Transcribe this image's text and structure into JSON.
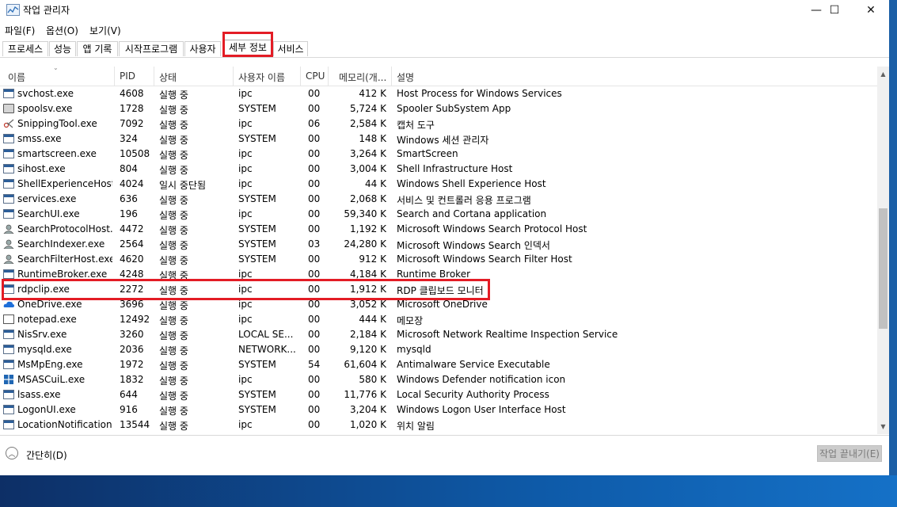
{
  "window": {
    "title": "작업 관리자",
    "minimize": "—",
    "maximize": "☐",
    "close": "✕"
  },
  "menu": [
    "파일(F)",
    "옵션(O)",
    "보기(V)"
  ],
  "tabs": [
    "프로세스",
    "성능",
    "앱 기록",
    "시작프로그램",
    "사용자",
    "세부 정보",
    "서비스"
  ],
  "active_tab": "세부 정보",
  "columns": [
    "이름",
    "PID",
    "상태",
    "사용자 이름",
    "CPU",
    "메모리(개...",
    "설명"
  ],
  "rows": [
    {
      "name": "svchost.exe",
      "pid": "4608",
      "status": "실행 중",
      "user": "ipc",
      "cpu": "00",
      "mem": "412 K",
      "desc": "Host Process for Windows Services",
      "icon": "app-icon"
    },
    {
      "name": "spoolsv.exe",
      "pid": "1728",
      "status": "실행 중",
      "user": "SYSTEM",
      "cpu": "00",
      "mem": "5,724 K",
      "desc": "Spooler SubSystem App",
      "icon": "printer-icon"
    },
    {
      "name": "SnippingTool.exe",
      "pid": "7092",
      "status": "실행 중",
      "user": "ipc",
      "cpu": "06",
      "mem": "2,584 K",
      "desc": "캡처 도구",
      "icon": "scissors-icon"
    },
    {
      "name": "smss.exe",
      "pid": "324",
      "status": "실행 중",
      "user": "SYSTEM",
      "cpu": "00",
      "mem": "148 K",
      "desc": "Windows 세션 관리자",
      "icon": "app-icon"
    },
    {
      "name": "smartscreen.exe",
      "pid": "10508",
      "status": "실행 중",
      "user": "ipc",
      "cpu": "00",
      "mem": "3,264 K",
      "desc": "SmartScreen",
      "icon": "app-icon"
    },
    {
      "name": "sihost.exe",
      "pid": "804",
      "status": "실행 중",
      "user": "ipc",
      "cpu": "00",
      "mem": "3,004 K",
      "desc": "Shell Infrastructure Host",
      "icon": "app-icon"
    },
    {
      "name": "ShellExperienceHost...",
      "pid": "4024",
      "status": "일시 중단됨",
      "user": "ipc",
      "cpu": "00",
      "mem": "44 K",
      "desc": "Windows Shell Experience Host",
      "icon": "app-icon"
    },
    {
      "name": "services.exe",
      "pid": "636",
      "status": "실행 중",
      "user": "SYSTEM",
      "cpu": "00",
      "mem": "2,068 K",
      "desc": "서비스 및 컨트롤러 응용 프로그램",
      "icon": "app-icon"
    },
    {
      "name": "SearchUI.exe",
      "pid": "196",
      "status": "실행 중",
      "user": "ipc",
      "cpu": "00",
      "mem": "59,340 K",
      "desc": "Search and Cortana application",
      "icon": "app-icon"
    },
    {
      "name": "SearchProtocolHost....",
      "pid": "4472",
      "status": "실행 중",
      "user": "SYSTEM",
      "cpu": "00",
      "mem": "1,192 K",
      "desc": "Microsoft Windows Search Protocol Host",
      "icon": "search-user-icon"
    },
    {
      "name": "SearchIndexer.exe",
      "pid": "2564",
      "status": "실행 중",
      "user": "SYSTEM",
      "cpu": "03",
      "mem": "24,280 K",
      "desc": "Microsoft Windows Search 인덱서",
      "icon": "search-user-icon"
    },
    {
      "name": "SearchFilterHost.exe",
      "pid": "4620",
      "status": "실행 중",
      "user": "SYSTEM",
      "cpu": "00",
      "mem": "912 K",
      "desc": "Microsoft Windows Search Filter Host",
      "icon": "search-user-icon"
    },
    {
      "name": "RuntimeBroker.exe",
      "pid": "4248",
      "status": "실행 중",
      "user": "ipc",
      "cpu": "00",
      "mem": "4,184 K",
      "desc": "Runtime Broker",
      "icon": "app-icon"
    },
    {
      "name": "rdpclip.exe",
      "pid": "2272",
      "status": "실행 중",
      "user": "ipc",
      "cpu": "00",
      "mem": "1,912 K",
      "desc": "RDP 클립보드 모니터",
      "icon": "app-icon"
    },
    {
      "name": "OneDrive.exe",
      "pid": "3696",
      "status": "실행 중",
      "user": "ipc",
      "cpu": "00",
      "mem": "3,052 K",
      "desc": "Microsoft OneDrive",
      "icon": "cloud-icon"
    },
    {
      "name": "notepad.exe",
      "pid": "12492",
      "status": "실행 중",
      "user": "ipc",
      "cpu": "00",
      "mem": "444 K",
      "desc": "메모장",
      "icon": "notepad-icon"
    },
    {
      "name": "NisSrv.exe",
      "pid": "3260",
      "status": "실행 중",
      "user": "LOCAL SE...",
      "cpu": "00",
      "mem": "2,184 K",
      "desc": "Microsoft Network Realtime Inspection Service",
      "icon": "app-icon"
    },
    {
      "name": "mysqld.exe",
      "pid": "2036",
      "status": "실행 중",
      "user": "NETWORK...",
      "cpu": "00",
      "mem": "9,120 K",
      "desc": "mysqld",
      "icon": "app-icon"
    },
    {
      "name": "MsMpEng.exe",
      "pid": "1972",
      "status": "실행 중",
      "user": "SYSTEM",
      "cpu": "54",
      "mem": "61,604 K",
      "desc": "Antimalware Service Executable",
      "icon": "app-icon"
    },
    {
      "name": "MSASCuiL.exe",
      "pid": "1832",
      "status": "실행 중",
      "user": "ipc",
      "cpu": "00",
      "mem": "580 K",
      "desc": "Windows Defender notification icon",
      "icon": "defender-icon"
    },
    {
      "name": "lsass.exe",
      "pid": "644",
      "status": "실행 중",
      "user": "SYSTEM",
      "cpu": "00",
      "mem": "11,776 K",
      "desc": "Local Security Authority Process",
      "icon": "app-icon"
    },
    {
      "name": "LogonUI.exe",
      "pid": "916",
      "status": "실행 중",
      "user": "SYSTEM",
      "cpu": "00",
      "mem": "3,204 K",
      "desc": "Windows Logon User Interface Host",
      "icon": "app-icon"
    },
    {
      "name": "LocationNotification...",
      "pid": "13544",
      "status": "실행 중",
      "user": "ipc",
      "cpu": "00",
      "mem": "1,020 K",
      "desc": "위치 알림",
      "icon": "app-icon"
    }
  ],
  "highlighted_row": "rdpclip.exe",
  "footer": {
    "collapse_label": "간단히(D)",
    "end_task_label": "작업 끝내기(E)"
  },
  "colors": {
    "highlight": "#e31c25",
    "taskbar": "#0e5aa8"
  }
}
